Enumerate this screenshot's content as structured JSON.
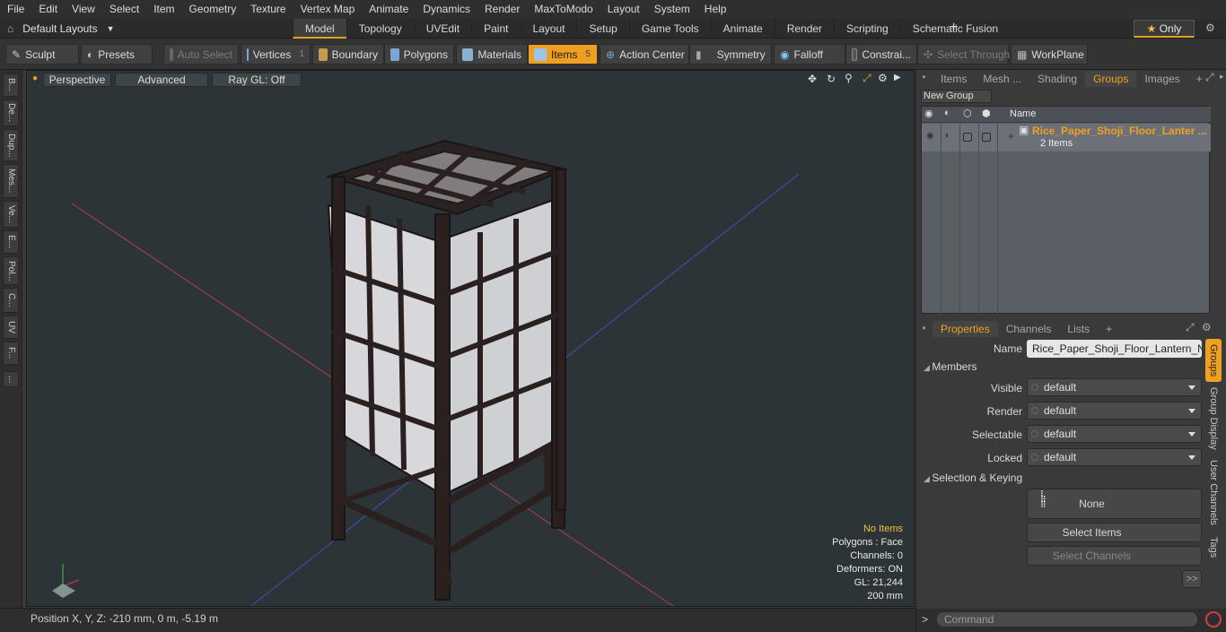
{
  "menu": [
    "File",
    "Edit",
    "View",
    "Select",
    "Item",
    "Geometry",
    "Texture",
    "Vertex Map",
    "Animate",
    "Dynamics",
    "Render",
    "MaxToModo",
    "Layout",
    "System",
    "Help"
  ],
  "layouts_label": "Default Layouts",
  "mode_tabs": [
    "Model",
    "Topology",
    "UVEdit",
    "Paint",
    "Layout",
    "Setup",
    "Game Tools",
    "Animate",
    "Render",
    "Scripting",
    "Schematic Fusion"
  ],
  "only_label": "Only",
  "toolbar": {
    "sculpt": "Sculpt",
    "presets": "Presets",
    "auto_select": "Auto Select",
    "vertices": "Vertices",
    "vertices_count": "1",
    "boundary": "Boundary",
    "polygons": "Polygons",
    "materials": "Materials",
    "items": "Items",
    "items_count": "5",
    "action_center": "Action Center",
    "symmetry": "Symmetry",
    "falloff": "Falloff",
    "constraints": "Constrai...",
    "select_through": "Select Through",
    "workplane": "WorkPlane"
  },
  "left_tabs": [
    "B...",
    "De...",
    "Dup...",
    "Mes...",
    "Ve...",
    "E...",
    "Pol...",
    "C...",
    "UV",
    "F...",
    "..."
  ],
  "viewport": {
    "view": "Perspective",
    "shading": "Advanced",
    "raygl": "Ray GL: Off",
    "info": [
      "No Items",
      "Polygons : Face",
      "Channels: 0",
      "Deformers: ON",
      "GL: 21,244",
      "200 mm"
    ]
  },
  "status": "Position X, Y, Z:   -210 mm, 0 m, -5.19 m",
  "right_tabs": [
    "Items",
    "Mesh ...",
    "Shading",
    "Groups",
    "Images"
  ],
  "new_group": "New Group",
  "list_header_name": "Name",
  "group": {
    "name": "Rice_Paper_Shoji_Floor_Lanter ...",
    "count": "2 Items"
  },
  "props_tabs": [
    "Properties",
    "Channels",
    "Lists"
  ],
  "props": {
    "name_label": "Name",
    "name_value": "Rice_Paper_Shoji_Floor_Lantern_Nigh",
    "members": "Members",
    "visible_label": "Visible",
    "render_label": "Render",
    "selectable_label": "Selectable",
    "locked_label": "Locked",
    "default": "default",
    "sel_keying": "Selection & Keying",
    "none": "None",
    "select_items": "Select Items",
    "select_channels": "Select Channels",
    "more": ">>"
  },
  "side_tabs": [
    "Groups",
    "Group Display",
    "User Channels",
    "Tags"
  ],
  "command_placeholder": "Command",
  "colors": {
    "accent": "#f0a020",
    "viewport_bg": "#2d3438"
  }
}
